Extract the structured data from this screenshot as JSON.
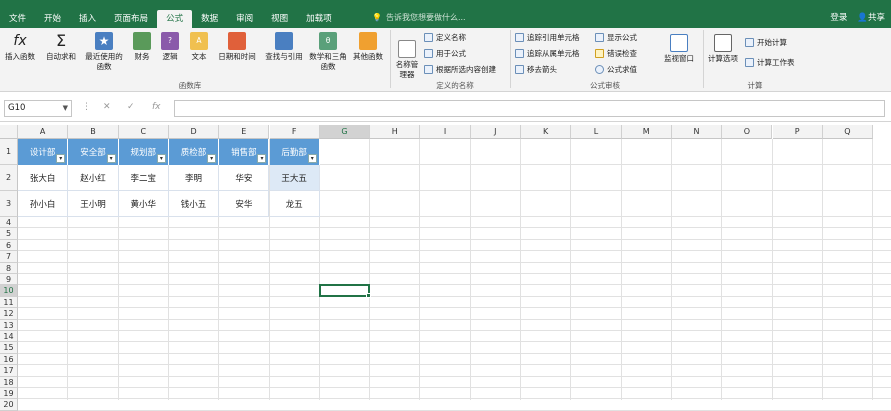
{
  "tabs": [
    "文件",
    "开始",
    "插入",
    "页面布局",
    "公式",
    "数据",
    "审阅",
    "视图",
    "加载项"
  ],
  "tell": "告诉我您想要做什么...",
  "right": {
    "login": "登录",
    "share": "共享"
  },
  "ribbon": {
    "insert_fn": "插入函数",
    "autosum": "自动求和",
    "recent": "最近使用的函数",
    "finance": "财务",
    "logic": "逻辑",
    "text": "文本",
    "datetime": "日期和时间",
    "lookup": "查找与引用",
    "math": "数学和三角函数",
    "more": "其他函数",
    "group_lib": "函数库",
    "name_mgr": "名称管理器",
    "define_name": "定义名称",
    "use_in_formula": "用于公式",
    "create_from_sel": "根据所选内容创建",
    "group_names": "定义的名称",
    "trace_prec": "追踪引用单元格",
    "trace_dep": "追踪从属单元格",
    "remove_arrows": "移去箭头",
    "show_formulas": "显示公式",
    "error_check": "错误检查",
    "eval_formula": "公式求值",
    "watch": "监视窗口",
    "group_audit": "公式审核",
    "calc_opts": "计算选项",
    "calc_now": "开始计算",
    "calc_sheet": "计算工作表",
    "group_calc": "计算"
  },
  "namebox": "G10",
  "columns": [
    "A",
    "B",
    "C",
    "D",
    "E",
    "F",
    "G",
    "H",
    "I",
    "J",
    "K",
    "L",
    "M",
    "N",
    "O",
    "P",
    "Q"
  ],
  "rows": [
    "1",
    "2",
    "3",
    "4",
    "5",
    "6",
    "7",
    "8",
    "9",
    "10",
    "11",
    "12",
    "13",
    "14",
    "15",
    "16",
    "17",
    "18",
    "19",
    "20"
  ],
  "table": {
    "headers": [
      "设计部",
      "安全部",
      "规划部",
      "质检部",
      "销售部",
      "后勤部"
    ],
    "row2": [
      "张大白",
      "赵小红",
      "李二宝",
      "李明",
      "华安",
      "王大五"
    ],
    "row3": [
      "孙小白",
      "王小明",
      "黄小华",
      "钱小五",
      "安华",
      "龙五"
    ]
  },
  "colors": {
    "green": "#217346",
    "header_blue": "#5b9bd5"
  }
}
